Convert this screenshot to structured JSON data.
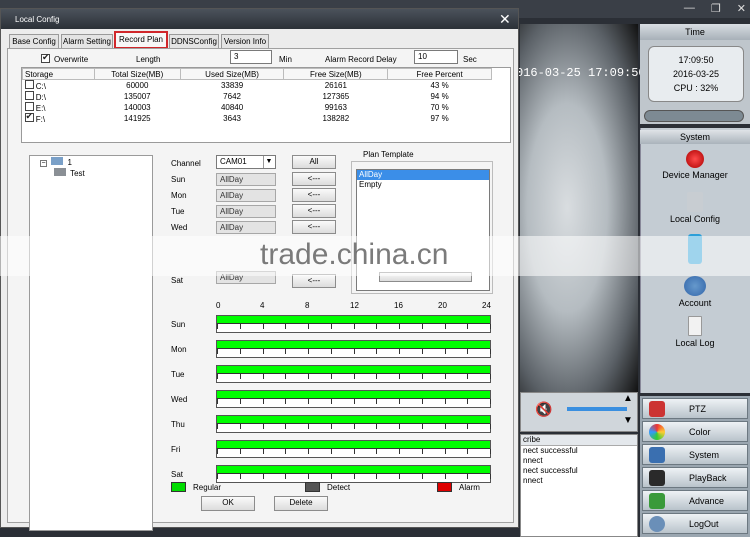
{
  "dialog": {
    "title": "Local Config",
    "close": "✕",
    "tabs": [
      "Base Config",
      "Alarm Setting",
      "Record Plan",
      "DDNSConfig",
      "Version Info"
    ],
    "active_tab": "Record Plan"
  },
  "record": {
    "overwrite_label": "Overwrite",
    "overwrite_checked": true,
    "length_label": "Length",
    "length_value": "3",
    "length_unit": "Min",
    "delay_label": "Alarm Record Delay",
    "delay_value": "10",
    "delay_unit": "Sec"
  },
  "storage": {
    "headers": [
      "Storage",
      "Total Size(MB)",
      "Used Size(MB)",
      "Free Size(MB)",
      "Free Percent"
    ],
    "rows": [
      {
        "name": "C:\\",
        "total": "60000",
        "used": "33839",
        "free": "26161",
        "pct": "43 %",
        "checked": false
      },
      {
        "name": "D:\\",
        "total": "135007",
        "used": "7642",
        "free": "127365",
        "pct": "94 %",
        "checked": false
      },
      {
        "name": "E:\\",
        "total": "140003",
        "used": "40840",
        "free": "99163",
        "pct": "70 %",
        "checked": false
      },
      {
        "name": "F:\\",
        "total": "141925",
        "used": "3643",
        "free": "138282",
        "pct": "97 %",
        "checked": true
      }
    ]
  },
  "tree": {
    "root": "1",
    "child": "Test"
  },
  "channel": {
    "label": "Channel",
    "value": "CAM01",
    "all_button": "All",
    "days": [
      {
        "label": "Sun",
        "value": "AllDay",
        "button": "<---"
      },
      {
        "label": "Mon",
        "value": "AllDay",
        "button": "<---"
      },
      {
        "label": "Tue",
        "value": "AllDay",
        "button": "<---"
      },
      {
        "label": "Wed",
        "value": "AllDay",
        "button": "<---"
      },
      {
        "label": "Sat",
        "value": "AllDay",
        "button": "<---"
      }
    ]
  },
  "plan_template": {
    "title": "Plan Template",
    "items": [
      "AllDay",
      "Empty"
    ],
    "selected": "AllDay"
  },
  "timeline": {
    "hours": [
      "0",
      "4",
      "8",
      "12",
      "16",
      "20",
      "24"
    ],
    "days": [
      "Sun",
      "Mon",
      "Tue",
      "Wed",
      "Thu",
      "Fri",
      "Sat"
    ],
    "regular_fraction": [
      1,
      1,
      1,
      1,
      1,
      1,
      1
    ]
  },
  "legend": [
    {
      "label": "Regular",
      "color": "#00dd00"
    },
    {
      "label": "Detect",
      "color": "#555555"
    },
    {
      "label": "Alarm",
      "color": "#dd0000"
    }
  ],
  "footer": {
    "ok": "OK",
    "delete": "Delete"
  },
  "background": {
    "time_tab": "Time",
    "clock_time": "17:09:50",
    "clock_date": "2016-03-25",
    "cpu": "CPU : 32%",
    "video_timestamp": "016-03-25 17:09:50",
    "system_tab": "System",
    "system_items": [
      "Device Manager",
      "Local Config",
      "Account",
      "Local Log"
    ],
    "menu": [
      "PTZ",
      "Color",
      "System",
      "PlayBack",
      "Advance",
      "LogOut"
    ],
    "log_header": "cribe",
    "log_lines": [
      "nect successful",
      "nnect",
      "nect successful",
      "nnect"
    ]
  },
  "watermark": "trade.china.cn"
}
